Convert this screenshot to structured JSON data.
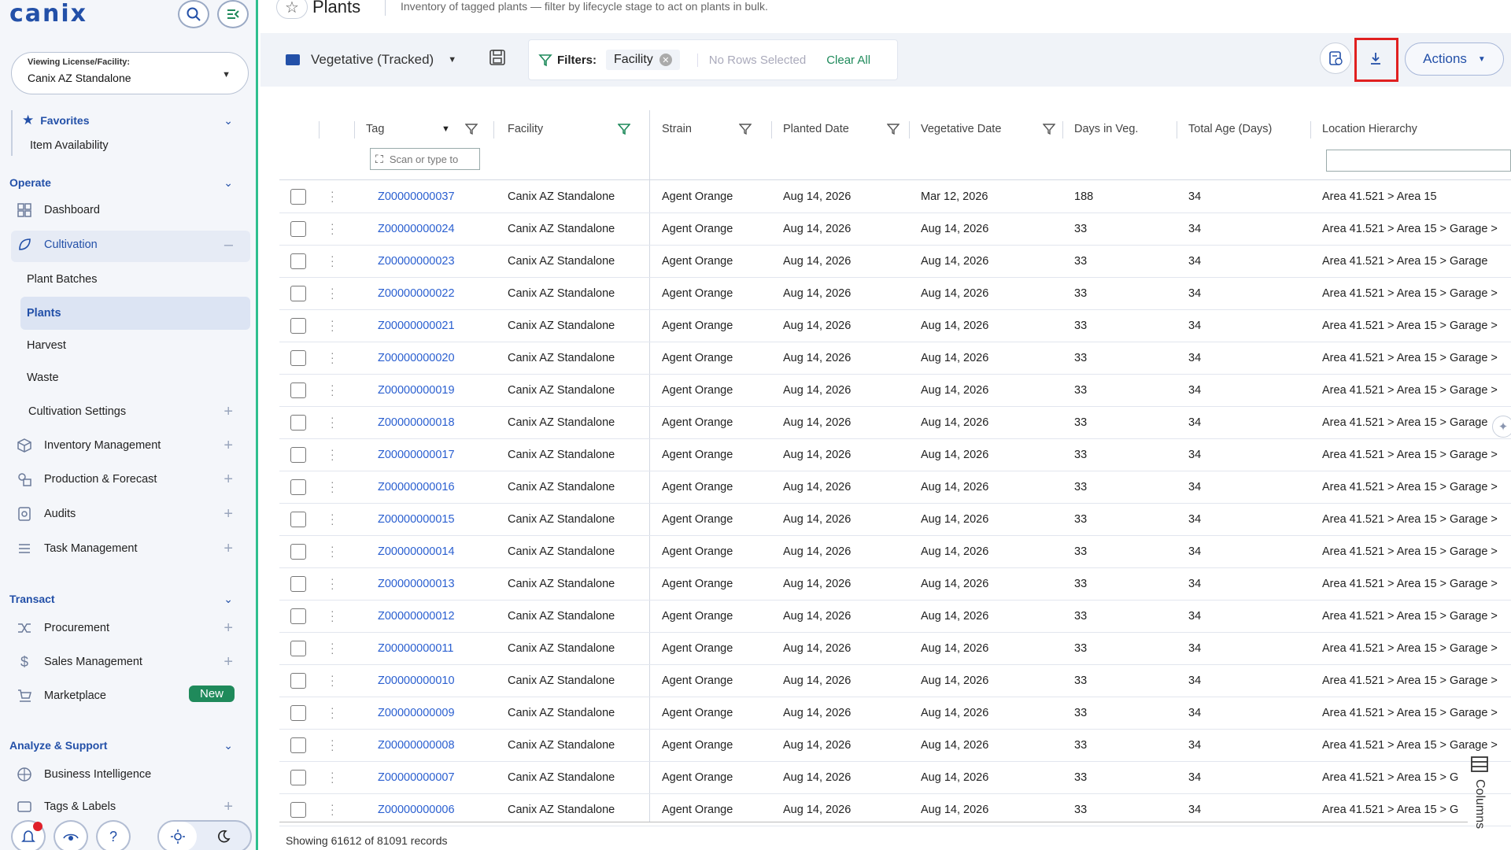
{
  "app": {
    "logo": "canix"
  },
  "sidebar": {
    "license": {
      "label": "Viewing License/Facility:",
      "value": "Canix AZ Standalone"
    },
    "favorites": {
      "title": "Favorites",
      "items": [
        "Item Availability"
      ]
    },
    "operate": {
      "title": "Operate",
      "dashboard": "Dashboard",
      "cultivation": "Cultivation",
      "cultivation_children": [
        "Plant Batches",
        "Plants",
        "Harvest",
        "Waste",
        "Cultivation Settings"
      ],
      "inventory": "Inventory Management",
      "production": "Production & Forecast",
      "audits": "Audits",
      "tasks": "Task Management"
    },
    "transact": {
      "title": "Transact",
      "procurement": "Procurement",
      "sales": "Sales Management",
      "marketplace": "Marketplace",
      "new_badge": "New"
    },
    "analyze": {
      "title": "Analyze & Support",
      "bi": "Business Intelligence",
      "tags": "Tags & Labels"
    }
  },
  "header": {
    "title": "Plants",
    "description": "Inventory of tagged plants — filter by lifecycle stage to act on plants in bulk."
  },
  "toolbar": {
    "view": "Vegetative (Tracked)",
    "filters_label": "Filters:",
    "chip": "Facility",
    "no_rows": "No Rows Selected",
    "clear_all": "Clear All",
    "actions": "Actions"
  },
  "grid": {
    "columns": [
      "Tag",
      "Facility",
      "Strain",
      "Planted Date",
      "Vegetative Date",
      "Days in Veg.",
      "Total Age (Days)",
      "Location Hierarchy"
    ],
    "scan_placeholder": "Scan or type to",
    "rows": [
      [
        "Z00000000037",
        "Canix AZ Standalone",
        "Agent Orange",
        "Aug 14, 2026",
        "Mar 12, 2026",
        "188",
        "34",
        "Area 41.521 > Area 15"
      ],
      [
        "Z00000000024",
        "Canix AZ Standalone",
        "Agent Orange",
        "Aug 14, 2026",
        "Aug 14, 2026",
        "33",
        "34",
        "Area 41.521 > Area 15 > Garage >"
      ],
      [
        "Z00000000023",
        "Canix AZ Standalone",
        "Agent Orange",
        "Aug 14, 2026",
        "Aug 14, 2026",
        "33",
        "34",
        "Area 41.521 > Area 15 > Garage"
      ],
      [
        "Z00000000022",
        "Canix AZ Standalone",
        "Agent Orange",
        "Aug 14, 2026",
        "Aug 14, 2026",
        "33",
        "34",
        "Area 41.521 > Area 15 > Garage >"
      ],
      [
        "Z00000000021",
        "Canix AZ Standalone",
        "Agent Orange",
        "Aug 14, 2026",
        "Aug 14, 2026",
        "33",
        "34",
        "Area 41.521 > Area 15 > Garage >"
      ],
      [
        "Z00000000020",
        "Canix AZ Standalone",
        "Agent Orange",
        "Aug 14, 2026",
        "Aug 14, 2026",
        "33",
        "34",
        "Area 41.521 > Area 15 > Garage >"
      ],
      [
        "Z00000000019",
        "Canix AZ Standalone",
        "Agent Orange",
        "Aug 14, 2026",
        "Aug 14, 2026",
        "33",
        "34",
        "Area 41.521 > Area 15 > Garage >"
      ],
      [
        "Z00000000018",
        "Canix AZ Standalone",
        "Agent Orange",
        "Aug 14, 2026",
        "Aug 14, 2026",
        "33",
        "34",
        "Area 41.521 > Area 15 > Garage"
      ],
      [
        "Z00000000017",
        "Canix AZ Standalone",
        "Agent Orange",
        "Aug 14, 2026",
        "Aug 14, 2026",
        "33",
        "34",
        "Area 41.521 > Area 15 > Garage >"
      ],
      [
        "Z00000000016",
        "Canix AZ Standalone",
        "Agent Orange",
        "Aug 14, 2026",
        "Aug 14, 2026",
        "33",
        "34",
        "Area 41.521 > Area 15 > Garage >"
      ],
      [
        "Z00000000015",
        "Canix AZ Standalone",
        "Agent Orange",
        "Aug 14, 2026",
        "Aug 14, 2026",
        "33",
        "34",
        "Area 41.521 > Area 15 > Garage >"
      ],
      [
        "Z00000000014",
        "Canix AZ Standalone",
        "Agent Orange",
        "Aug 14, 2026",
        "Aug 14, 2026",
        "33",
        "34",
        "Area 41.521 > Area 15 > Garage >"
      ],
      [
        "Z00000000013",
        "Canix AZ Standalone",
        "Agent Orange",
        "Aug 14, 2026",
        "Aug 14, 2026",
        "33",
        "34",
        "Area 41.521 > Area 15 > Garage >"
      ],
      [
        "Z00000000012",
        "Canix AZ Standalone",
        "Agent Orange",
        "Aug 14, 2026",
        "Aug 14, 2026",
        "33",
        "34",
        "Area 41.521 > Area 15 > Garage >"
      ],
      [
        "Z00000000011",
        "Canix AZ Standalone",
        "Agent Orange",
        "Aug 14, 2026",
        "Aug 14, 2026",
        "33",
        "34",
        "Area 41.521 > Area 15 > Garage >"
      ],
      [
        "Z00000000010",
        "Canix AZ Standalone",
        "Agent Orange",
        "Aug 14, 2026",
        "Aug 14, 2026",
        "33",
        "34",
        "Area 41.521 > Area 15 > Garage >"
      ],
      [
        "Z00000000009",
        "Canix AZ Standalone",
        "Agent Orange",
        "Aug 14, 2026",
        "Aug 14, 2026",
        "33",
        "34",
        "Area 41.521 > Area 15 > Garage >"
      ],
      [
        "Z00000000008",
        "Canix AZ Standalone",
        "Agent Orange",
        "Aug 14, 2026",
        "Aug 14, 2026",
        "33",
        "34",
        "Area 41.521 > Area 15 > Garage >"
      ],
      [
        "Z00000000007",
        "Canix AZ Standalone",
        "Agent Orange",
        "Aug 14, 2026",
        "Aug 14, 2026",
        "33",
        "34",
        "Area 41.521 > Area 15 > G"
      ],
      [
        "Z00000000006",
        "Canix AZ Standalone",
        "Agent Orange",
        "Aug 14, 2026",
        "Aug 14, 2026",
        "33",
        "34",
        "Area 41.521 > Area 15 > G"
      ]
    ]
  },
  "footer": {
    "records": "Showing 61612 of 81091 records"
  },
  "columns_panel": {
    "label": "Columns"
  },
  "colors": {
    "brand": "#2350a8",
    "accent_green": "#1f8a5b",
    "link": "#2a5fd0",
    "highlight": "#e02020"
  }
}
